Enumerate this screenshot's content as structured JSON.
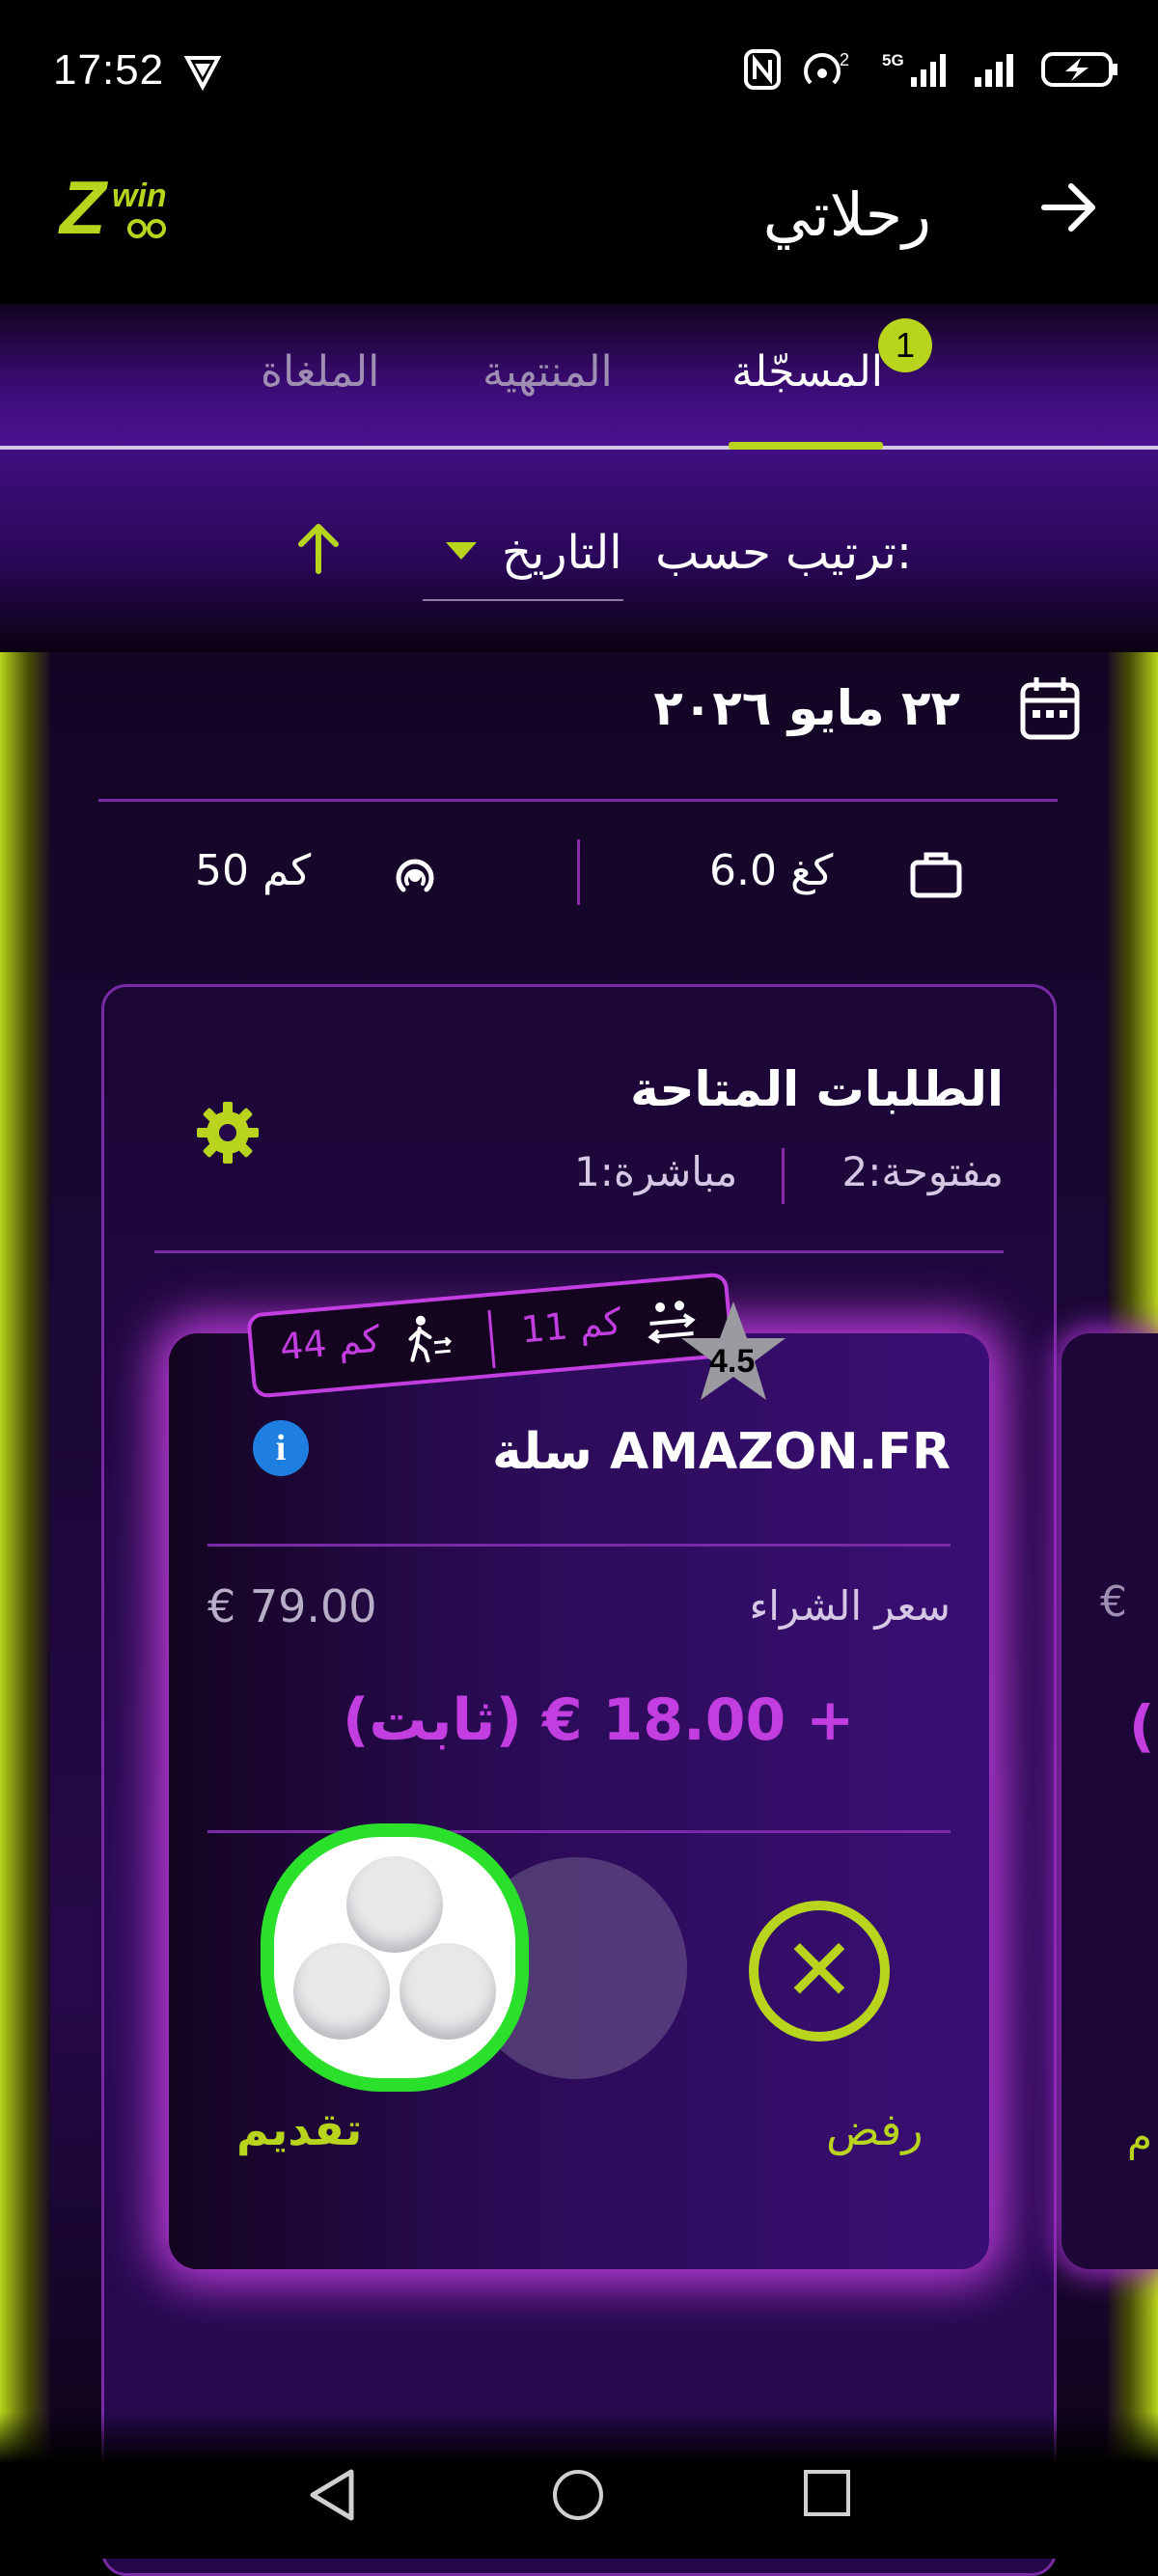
{
  "status_bar": {
    "time": "17:52",
    "network": "5G",
    "icons": [
      "vpn-icon",
      "nfc-icon",
      "hotspot-icon",
      "signal-icon",
      "signal-icon-2",
      "battery-charging-icon"
    ]
  },
  "header": {
    "logo_z": "Z",
    "logo_win": "win",
    "title": "رحلاتي",
    "back_icon": "arrow-right-icon"
  },
  "tabs": {
    "registered": "المسجّلة",
    "registered_badge": "1",
    "finished": "المنتهية",
    "cancelled": "الملغاة",
    "active": "registered"
  },
  "sort": {
    "label": "ترتيب حسب:",
    "value": "التاريخ"
  },
  "trip": {
    "date": "٢٢ مايو ٢٠٢٦",
    "weight": "6.0 كغ",
    "distance": "50 كم"
  },
  "requests": {
    "title": "الطلبات المتاحة",
    "open": "مفتوحة:2",
    "direct": "مباشرة:1"
  },
  "offer": {
    "tag_distance_1": "44 كم",
    "tag_distance_2": "11 كم",
    "rating": "4.5",
    "store": "AMAZON.FR سلة",
    "purchase_label": "سعر الشراء",
    "purchase_value": "€ 79.00",
    "fee": "+ 18.00 € (ثابت)",
    "reject_label": "رفض",
    "apply_label": "تقديم"
  },
  "next_card_peek": {
    "euro": "€",
    "paren": "(",
    "letter": "م"
  },
  "colors": {
    "accent_lime": "#b8d41c",
    "accent_magenta": "#c23ee0",
    "background_purple": "#2a0b55",
    "info_blue": "#1e7fe0",
    "touch_green": "#2ae02a"
  }
}
